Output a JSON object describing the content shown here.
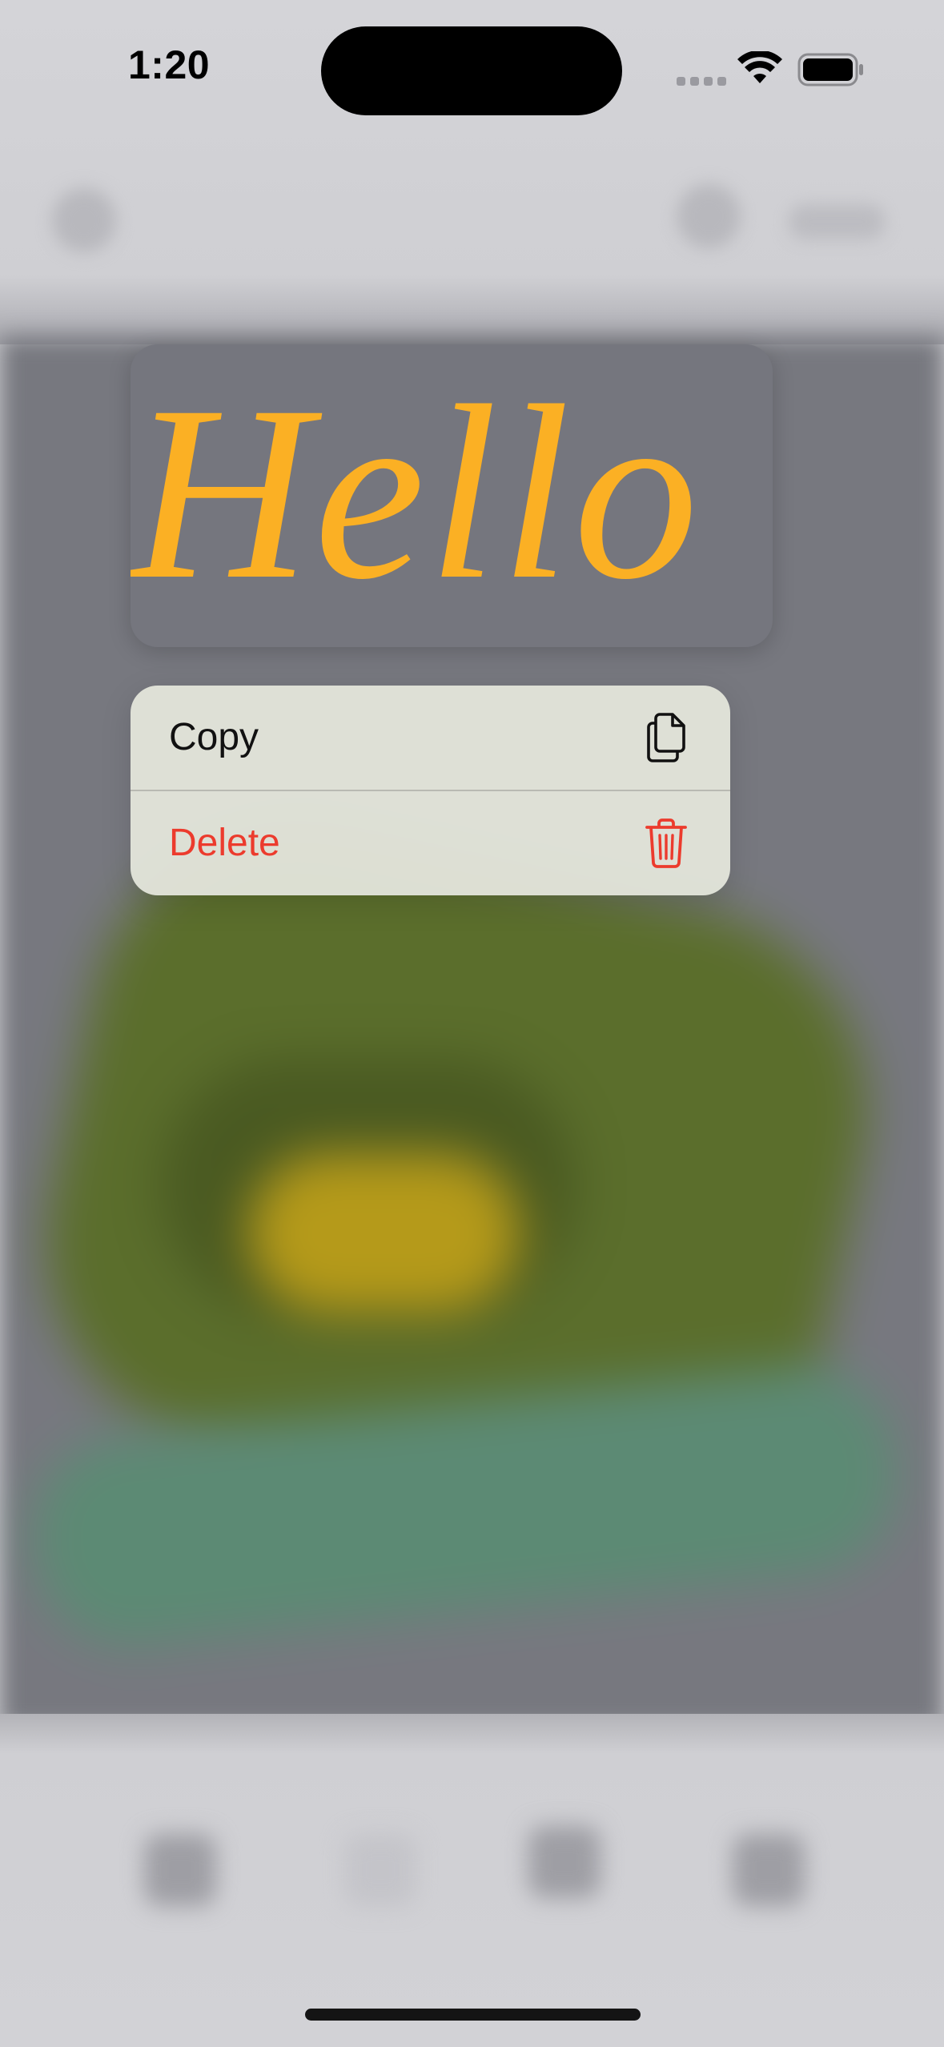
{
  "status_bar": {
    "time": "1:20"
  },
  "preview": {
    "text": "Hello !",
    "text_color": "#fbb024"
  },
  "context_menu": {
    "items": [
      {
        "label": "Copy",
        "icon": "copy-document-icon",
        "destructive": false
      },
      {
        "label": "Delete",
        "icon": "trash-icon",
        "destructive": true
      }
    ],
    "destructive_color": "#ec3b2d"
  }
}
